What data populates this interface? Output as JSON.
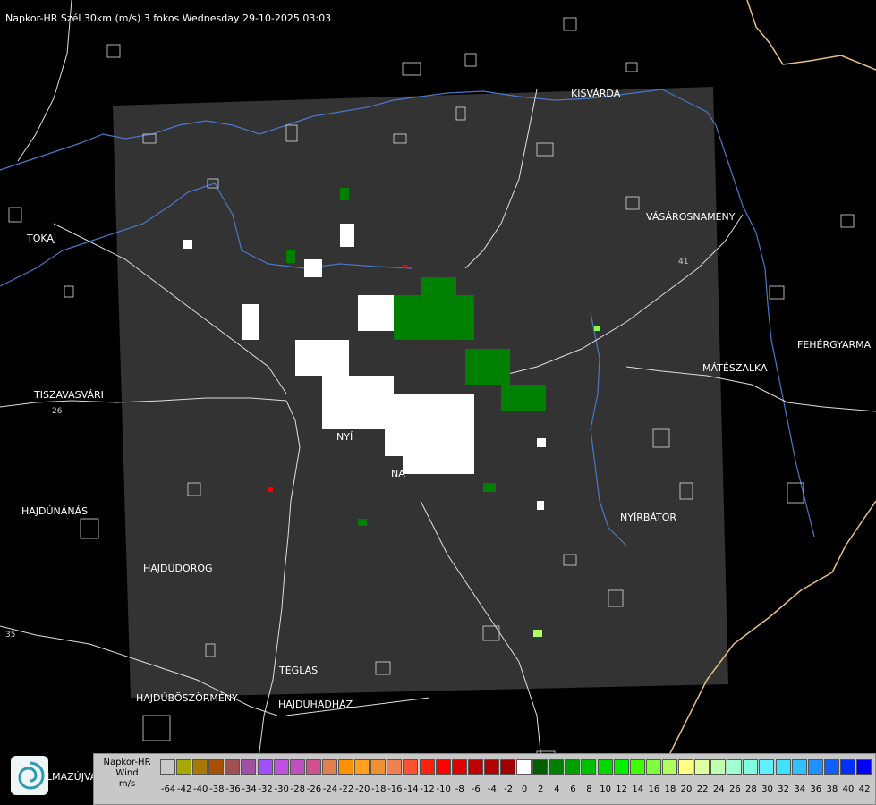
{
  "title": "Napkor-HR Szél 30km (m/s) 3 fokos Wednesday 29-10-2025 03:03",
  "cities": [
    {
      "id": "kisvarda",
      "label": "KISVÁRDA"
    },
    {
      "id": "vasarosnameny",
      "label": "VÁSÁROSNAMÉNY"
    },
    {
      "id": "tokaj",
      "label": "TOKAJ"
    },
    {
      "id": "fehergyarmat",
      "label": "FEHÉRGYARMA"
    },
    {
      "id": "mateszalka",
      "label": "MÁTÉSZALKA"
    },
    {
      "id": "tiszavasvari",
      "label": "TISZAVASVÁRI"
    },
    {
      "id": "hajdunanas",
      "label": "HAJDÚNÁNÁS"
    },
    {
      "id": "nyirbator",
      "label": "NYÍRBÁTOR"
    },
    {
      "id": "hajdudorog",
      "label": "HAJDÚDOROG"
    },
    {
      "id": "teglas",
      "label": "TÉGLÁS"
    },
    {
      "id": "hajduboszormeny",
      "label": "HAJDÚBÖSZÖRMÉNY"
    },
    {
      "id": "hajduhadhaz",
      "label": "HAJDÚHADHÁZ"
    },
    {
      "id": "nyiregyhaza",
      "label": "NYÍ"
    },
    {
      "id": "nagykallo",
      "label": "NA"
    }
  ],
  "road_numbers": [
    "41",
    "26",
    "35"
  ],
  "partial_text": "LMAZÚJVÁR",
  "legend": {
    "line1": "Napkor-HR",
    "line2": "Wind",
    "line3": "m/s",
    "ticks": [
      "-64",
      "-42",
      "-40",
      "-38",
      "-36",
      "-34",
      "-32",
      "-30",
      "-28",
      "-26",
      "-24",
      "-22",
      "-20",
      "-18",
      "-16",
      "-14",
      "-12",
      "-10",
      "-8",
      "-6",
      "-4",
      "-2",
      "0",
      "2",
      "4",
      "6",
      "8",
      "10",
      "12",
      "14",
      "16",
      "18",
      "20",
      "22",
      "24",
      "26",
      "28",
      "30",
      "32",
      "34",
      "36",
      "38",
      "40",
      "42"
    ],
    "colors": [
      "#c8c8c8",
      "#a8a800",
      "#a87800",
      "#a85000",
      "#a05050",
      "#a050a0",
      "#a050ff",
      "#c050e0",
      "#c050c0",
      "#d05090",
      "#e08050",
      "#ff9000",
      "#ffa020",
      "#f09030",
      "#f08050",
      "#ff5030",
      "#ff2010",
      "#ff0000",
      "#e00000",
      "#c00000",
      "#b00000",
      "#a00000",
      "#ffffff",
      "#006000",
      "#008000",
      "#00a000",
      "#00c000",
      "#00d800",
      "#00f000",
      "#40ff00",
      "#80ff40",
      "#b0ff60",
      "#ffff80",
      "#e0ffa0",
      "#c0ffb0",
      "#a0ffd0",
      "#80ffe0",
      "#60f0ff",
      "#40e0ff",
      "#30c0ff",
      "#2090ff",
      "#1060ff",
      "#0030ff",
      "#0000ff"
    ]
  }
}
